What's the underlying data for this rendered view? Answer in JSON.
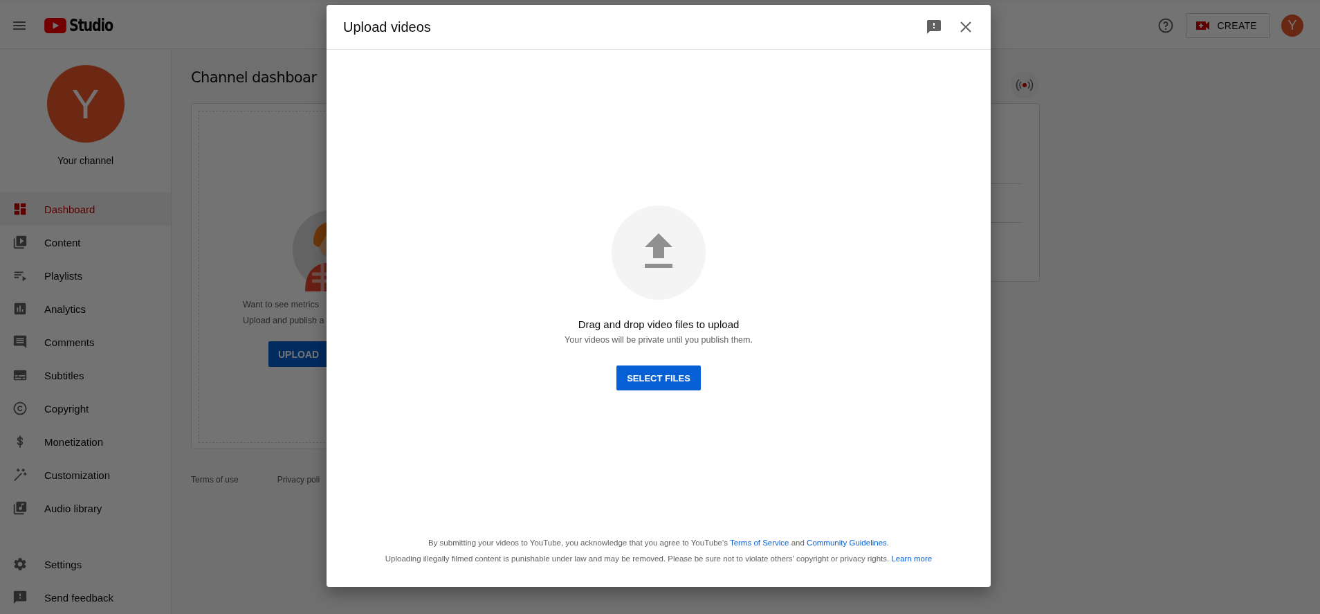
{
  "header": {
    "logo_text": "Studio",
    "create_label": "CREATE",
    "avatar_letter": "Y"
  },
  "sidebar": {
    "avatar_letter": "Y",
    "channel_label": "Your channel",
    "items": [
      {
        "label": "Dashboard",
        "selected": true
      },
      {
        "label": "Content",
        "selected": false
      },
      {
        "label": "Playlists",
        "selected": false
      },
      {
        "label": "Analytics",
        "selected": false
      },
      {
        "label": "Comments",
        "selected": false
      },
      {
        "label": "Subtitles",
        "selected": false
      },
      {
        "label": "Copyright",
        "selected": false
      },
      {
        "label": "Monetization",
        "selected": false
      },
      {
        "label": "Customization",
        "selected": false
      },
      {
        "label": "Audio library",
        "selected": false
      }
    ],
    "bottom_items": [
      {
        "label": "Settings",
        "selected": false
      },
      {
        "label": "Send feedback",
        "selected": false
      }
    ]
  },
  "dashboard": {
    "title": "Channel dashboar",
    "message_lines": [
      "Want to see metrics",
      "Upload and publish a"
    ],
    "upload_label": "UPLOAD",
    "footer_links": [
      "Terms of use",
      "Privacy poli"
    ]
  },
  "dialog": {
    "title": "Upload videos",
    "prompt": "Drag and drop video files to upload",
    "note": "Your videos will be private until you publish them.",
    "select_label": "SELECT FILES",
    "legal": [
      [
        {
          "text": "By submitting your videos to YouTube, you acknowledge that you agree to YouTube's ",
          "link": false
        },
        {
          "text": "Terms of Service",
          "link": true
        },
        {
          "text": " and ",
          "link": false
        },
        {
          "text": "Community Guidelines",
          "link": true
        },
        {
          "text": ".",
          "link": false
        }
      ],
      [
        {
          "text": "Uploading illegally filmed content is punishable under law and may be removed. Please be sure not to violate others' copyright or privacy rights. ",
          "link": false
        },
        {
          "text": "Learn more",
          "link": true
        }
      ]
    ]
  }
}
